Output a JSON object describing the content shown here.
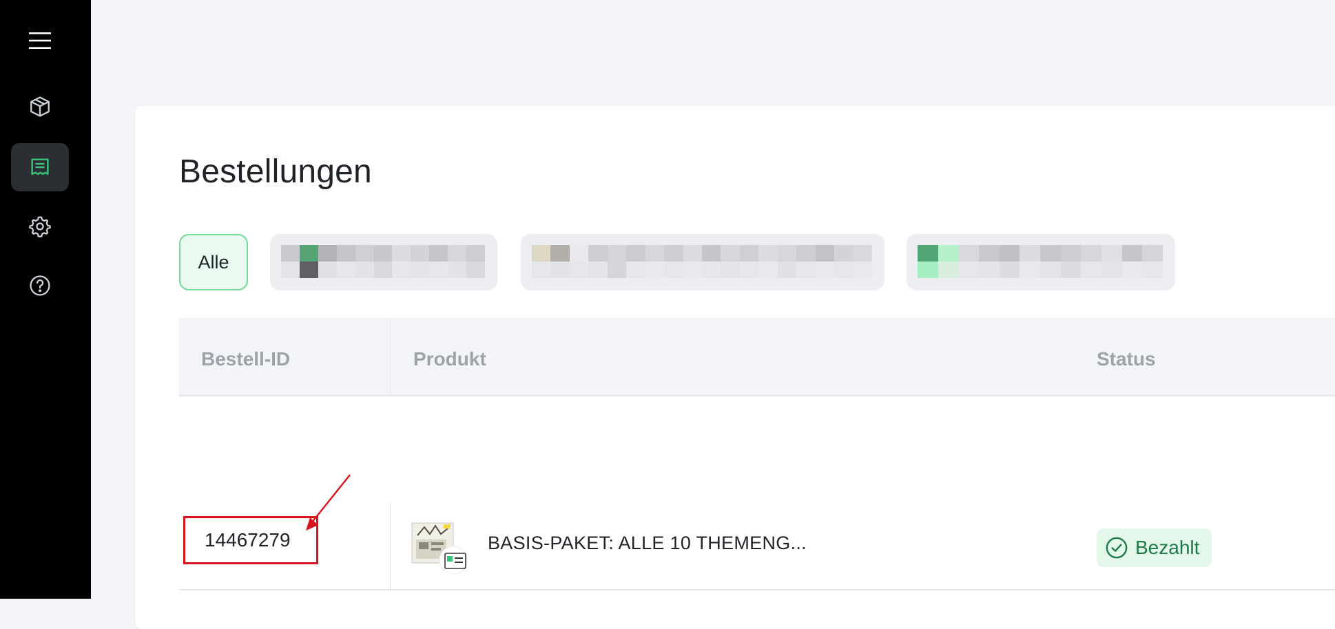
{
  "sidebar": {
    "items": [
      {
        "name": "menu",
        "icon": "hamburger-menu-icon"
      },
      {
        "name": "products",
        "icon": "package-icon"
      },
      {
        "name": "orders",
        "icon": "receipt-icon",
        "active": true
      },
      {
        "name": "settings",
        "icon": "gear-icon"
      },
      {
        "name": "help",
        "icon": "help-circle-icon"
      }
    ]
  },
  "page": {
    "title": "Bestellungen"
  },
  "filters": {
    "all_label": "Alle",
    "note": "other filter chips pixelated/redacted"
  },
  "table": {
    "columns": {
      "id": "Bestell-ID",
      "product": "Produkt",
      "status": "Status"
    },
    "rows": [
      {
        "id": "14467279",
        "product": "BASIS-PAKET: ALLE 10 THEMENG...",
        "status": "Bezahlt"
      }
    ]
  },
  "colors": {
    "accent_green": "#3ac47d",
    "annotation_red": "#d8141e",
    "status_bg": "#e3f8eb",
    "status_text": "#1e7a45"
  }
}
